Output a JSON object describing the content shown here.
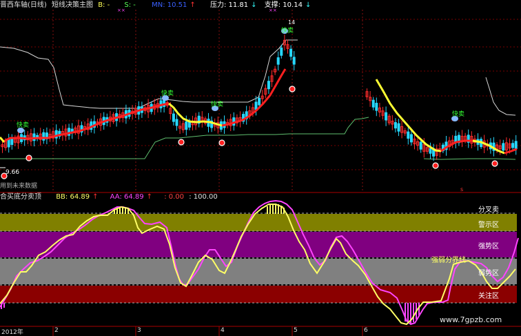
{
  "top_header": {
    "title": "晋西车轴(日线)",
    "indicator": "短线决策主图",
    "b_label": "B: -",
    "s_label": "S: -",
    "mn_label": "MN: 10.51",
    "mn_arrow": "↑",
    "resistance": "压力: 11.81",
    "resistance_arrow": "↓",
    "support": "支撑: 10.14",
    "support_arrow": "↓"
  },
  "price_markers": {
    "low_value": "9.66",
    "note": "用到未来数据",
    "buy_sell_badge": "快卖",
    "high_marker": "14"
  },
  "bottom_header": {
    "indicator": "合买底分卖顶",
    "bb": "BB: 64.89",
    "bb_arrow": "↑",
    "aa": "AA: 64.89",
    "aa_arrow": "↑",
    "c3": ": 0.00",
    "c4": ": 100.00"
  },
  "zones": {
    "divergence_sell": "分叉卖",
    "warning": "警示区",
    "strong": "强势区",
    "boundary": "强弱分界线",
    "weak": "弱势区",
    "attention": "关注区"
  },
  "x_axis": [
    "2012年",
    "2",
    "3",
    "4",
    "5",
    "6"
  ],
  "watermark": "www.7gpzb.com",
  "colors": {
    "up": "#ff2d2d",
    "down": "#27d8ff",
    "ma_red": "#ff2020",
    "ma_yellow": "#ffff33",
    "upper_band": "#d8d8d8",
    "lower_band": "#5fbf6f",
    "line_bb": "#ffff66",
    "line_aa": "#ff44ff",
    "zone_olive": "#808000",
    "zone_purple": "#800080",
    "zone_gray": "#808080",
    "zone_red": "#8b0000"
  }
}
